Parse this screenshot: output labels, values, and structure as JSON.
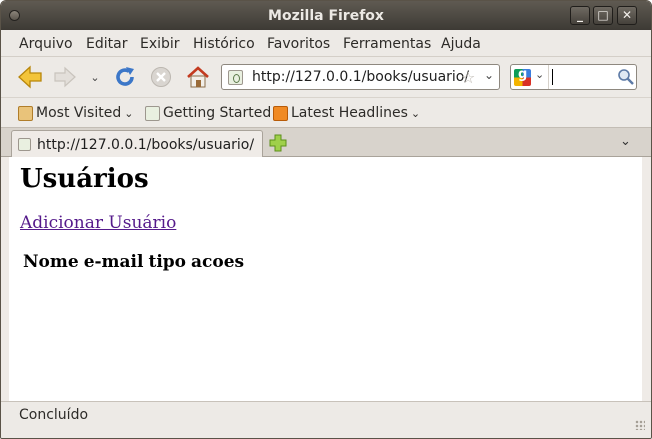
{
  "window": {
    "title": "Mozilla Firefox"
  },
  "menubar": {
    "items": [
      "Arquivo",
      "Editar",
      "Exibir",
      "Histórico",
      "Favoritos",
      "Ferramentas",
      "Ajuda"
    ]
  },
  "navbar": {
    "url": "http://127.0.0.1/books/usuario/",
    "search_value": ""
  },
  "bookmarks": {
    "items": [
      "Most Visited",
      "Getting Started",
      "Latest Headlines"
    ]
  },
  "tabs": [
    {
      "label": "http://127.0.0.1/books/usuario/"
    }
  ],
  "page": {
    "heading": "Usuários",
    "add_link": "Adicionar Usuário",
    "table_headers": [
      "Nome",
      "e-mail",
      "tipo",
      "acoes"
    ]
  },
  "status": {
    "text": "Concluído"
  },
  "colors": {
    "titlebar": "#3d3a35",
    "chrome": "#edeae6",
    "visited_link": "#551a8b"
  }
}
